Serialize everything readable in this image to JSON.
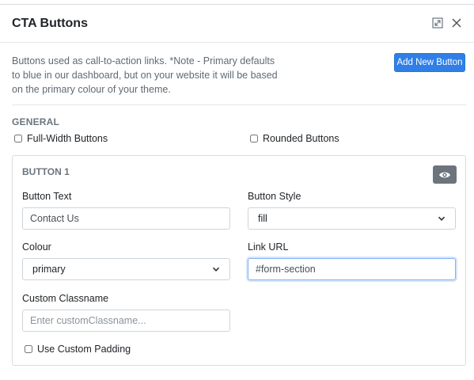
{
  "modal": {
    "title": "CTA Buttons",
    "expand_icon": "expand-icon",
    "close_icon": "close-icon"
  },
  "intro": {
    "text": "Buttons used as call-to-action links. *Note - Primary defaults to blue in our dashboard, but on your website it will be based on the primary colour of your theme."
  },
  "add_button": {
    "label": "Add New Button",
    "color": "#2f7fe6"
  },
  "general": {
    "title": "GENERAL",
    "full_width_label": "Full-Width Buttons",
    "full_width_checked": false,
    "rounded_label": "Rounded Buttons",
    "rounded_checked": false
  },
  "button1": {
    "title": "BUTTON 1",
    "preview_icon": "eye-icon",
    "button_text_label": "Button Text",
    "button_text_value": "Contact Us",
    "button_style_label": "Button Style",
    "button_style_value": "fill",
    "colour_label": "Colour",
    "colour_value": "primary",
    "link_url_label": "Link URL",
    "link_url_value": "#form-section",
    "custom_classname_label": "Custom Classname",
    "custom_classname_placeholder": "Enter customClassname...",
    "use_custom_padding_label": "Use Custom Padding",
    "use_custom_padding_checked": false
  }
}
